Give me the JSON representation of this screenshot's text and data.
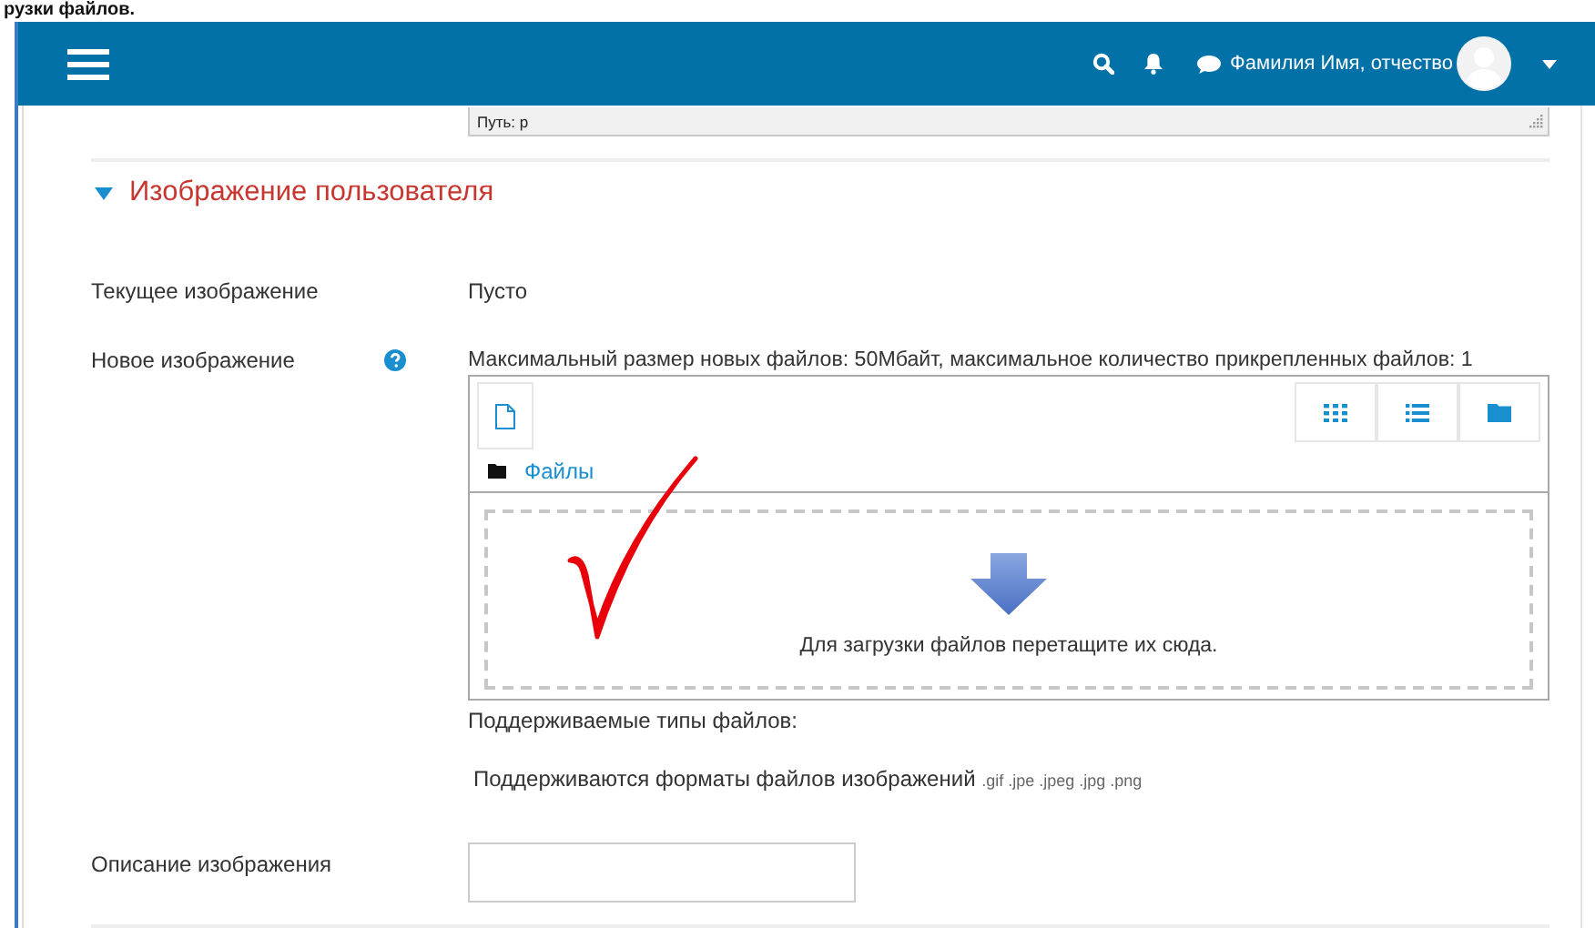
{
  "document_heading": "рузки файлов.",
  "navbar": {
    "user_name": "Фамилия Имя, отчество"
  },
  "editor_path": "Путь: p",
  "section": {
    "title": "Изображение пользователя",
    "expanded": true
  },
  "current_image": {
    "label": "Текущее изображение",
    "value": "Пусто"
  },
  "new_image": {
    "label": "Новое изображение",
    "help": true,
    "limits": "Максимальный размер новых файлов: 50Мбайт, максимальное количество прикрепленных файлов: 1",
    "view_modes": [
      {
        "kind": "icons"
      },
      {
        "kind": "list"
      },
      {
        "kind": "tree"
      }
    ],
    "breadcrumb": "Файлы",
    "drop_hint": "Для загрузки файлов перетащите их сюда."
  },
  "supported_types_label": "Поддерживаемые типы файлов:",
  "supported_formats": {
    "text": "Поддерживаются форматы файлов изображений",
    "extensions": ".gif .jpe .jpeg .jpg .png"
  },
  "description": {
    "label": "Описание изображения"
  }
}
